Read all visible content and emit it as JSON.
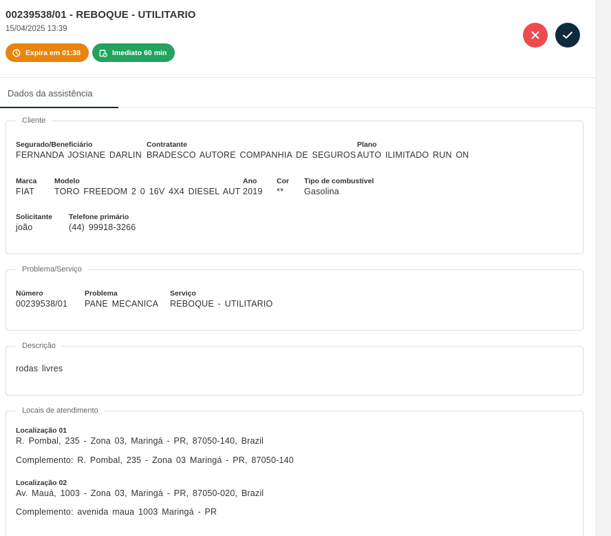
{
  "header": {
    "title": "00239538/01 - REBOQUE - UTILITARIO",
    "datetime": "15/04/2025 13:39",
    "badges": {
      "expiry": "Expira em 01:38",
      "urgency": "Imediato 60 min"
    },
    "colors": {
      "orange": "#e8850c",
      "green": "#23a35e",
      "reject": "#ee4b4f",
      "accept": "#0e2a3d"
    }
  },
  "tabs": [
    {
      "label": "Dados da assistência",
      "active": true
    }
  ],
  "cliente": {
    "legend": "Cliente",
    "segurado": {
      "label": "Segurado/Beneficiário",
      "value": "FERNANDA JOSIANE DARLIN"
    },
    "contratante": {
      "label": "Contratante",
      "value": "BRADESCO AUTORE COMPANHIA DE SEGUROS"
    },
    "plano": {
      "label": "Plano",
      "value": "AUTO ILIMITADO RUN ON"
    },
    "marca": {
      "label": "Marca",
      "value": "FIAT"
    },
    "modelo": {
      "label": "Modelo",
      "value": "TORO FREEDOM 2 0 16V 4X4 DIESEL AUT"
    },
    "ano": {
      "label": "Ano",
      "value": "2019"
    },
    "cor": {
      "label": "Cor",
      "value": "**"
    },
    "combustivel": {
      "label": "Tipo de combustível",
      "value": "Gasolina"
    },
    "solicitante": {
      "label": "Solicitante",
      "value": "joão"
    },
    "telefone": {
      "label": "Telefone primário",
      "value": "(44) 99918-3266"
    }
  },
  "problema": {
    "legend": "Problema/Serviço",
    "numero": {
      "label": "Número",
      "value": "00239538/01"
    },
    "problema": {
      "label": "Problema",
      "value": "PANE MECANICA"
    },
    "servico": {
      "label": "Serviço",
      "value": "REBOQUE - UTILITARIO"
    }
  },
  "descricao": {
    "legend": "Descrição",
    "text": "rodas livres"
  },
  "locais": {
    "legend": "Locais de atendimento",
    "items": [
      {
        "label": "Localização 01",
        "address": "R. Pombal, 235 - Zona 03, Maringá - PR, 87050-140, Brazil",
        "complemento": "Complemento: R. Pombal, 235 - Zona 03 Maringá - PR, 87050-140"
      },
      {
        "label": "Localização 02",
        "address": "Av. Mauá, 1003 - Zona 03, Maringá - PR, 87050-020, Brazil",
        "complemento": "Complemento: avenida maua 1003 Maringá - PR"
      }
    ]
  }
}
